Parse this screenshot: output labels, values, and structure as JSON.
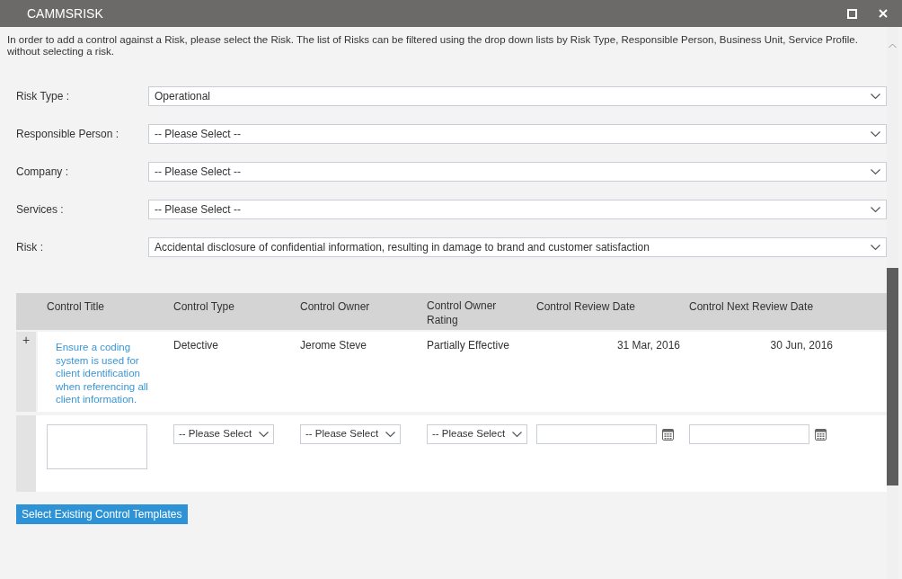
{
  "window": {
    "title": "CAMMSRISK"
  },
  "intro": [
    "In order to add a control against a Risk, please select the Risk. The list of Risks can be filtered using the drop down lists by Risk Type, Responsible Person, Business Unit, Service Profile.",
    "without selecting a risk."
  ],
  "filters": [
    {
      "label": "Risk Type :",
      "value": "Operational"
    },
    {
      "label": "Responsible Person :",
      "value": "-- Please Select --"
    },
    {
      "label": "Company :",
      "value": "-- Please Select --"
    },
    {
      "label": "Services :",
      "value": "-- Please Select --"
    },
    {
      "label": "Risk :",
      "value": "Accidental disclosure of confidential information, resulting in damage to brand and customer satisfaction"
    }
  ],
  "table": {
    "columns": [
      "Control Title",
      "Control Type",
      "Control Owner",
      "Control Owner Rating",
      "Control Review Date",
      "Control Next Review Date"
    ],
    "rows": [
      {
        "expander": "+",
        "title": "Ensure a coding system is used for client identification when referencing all client information.",
        "type": "Detective",
        "owner": "Jerome Steve",
        "rating": "Partially Effective",
        "review_date": "31 Mar, 2016",
        "next_review_date": "30 Jun, 2016"
      }
    ],
    "new_row": {
      "selects": [
        "-- Please Select",
        "-- Please Select",
        "-- Please Select"
      ]
    }
  },
  "button": "Select Existing Control Templates"
}
